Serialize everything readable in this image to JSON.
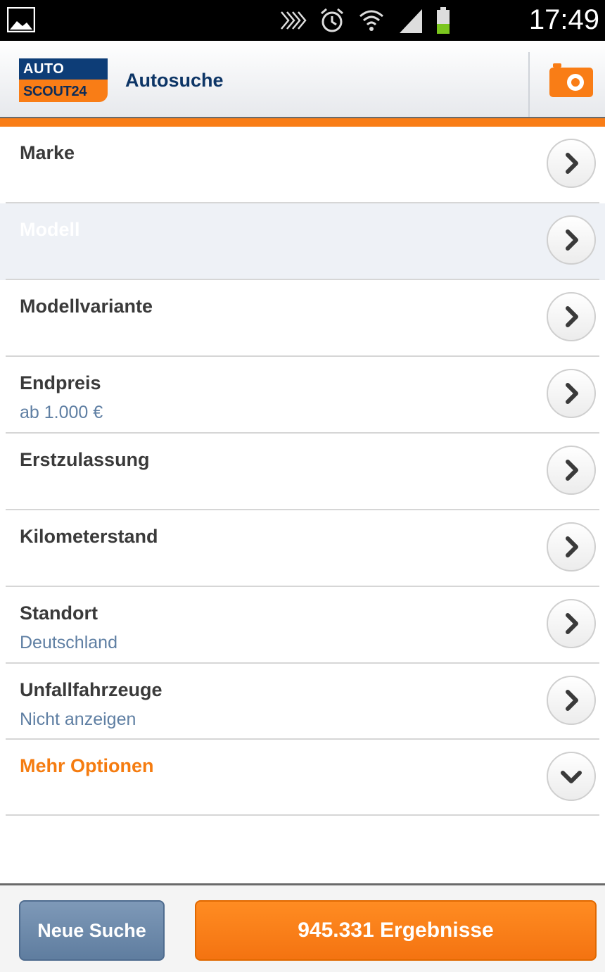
{
  "status_bar": {
    "time": "17:49",
    "icons": [
      "gallery-icon",
      "nfc-icon",
      "alarm-icon",
      "wifi-icon",
      "signal-icon",
      "battery-icon"
    ]
  },
  "header": {
    "logo_line1": "AUTO",
    "logo_line2": "SCOUT24",
    "title": "Autosuche",
    "action_icon": "camera-icon"
  },
  "filters": [
    {
      "label": "Marke",
      "value": ""
    },
    {
      "label": "Modell",
      "value": "",
      "disabled": true
    },
    {
      "label": "Modellvariante",
      "value": ""
    },
    {
      "label": "Endpreis",
      "value": "ab 1.000 €"
    },
    {
      "label": "Erstzulassung",
      "value": ""
    },
    {
      "label": "Kilometerstand",
      "value": ""
    },
    {
      "label": "Standort",
      "value": "Deutschland"
    },
    {
      "label": "Unfallfahrzeuge",
      "value": "Nicht anzeigen"
    }
  ],
  "more_options": {
    "label": "Mehr Optionen",
    "icon": "chevron-down-icon"
  },
  "buttons": {
    "new_search": "Neue Suche",
    "results": "945.331 Ergebnisse"
  },
  "colors": {
    "accent": "#f97d16",
    "brand_blue": "#0d3d77",
    "value_text": "#5f7fa3"
  }
}
